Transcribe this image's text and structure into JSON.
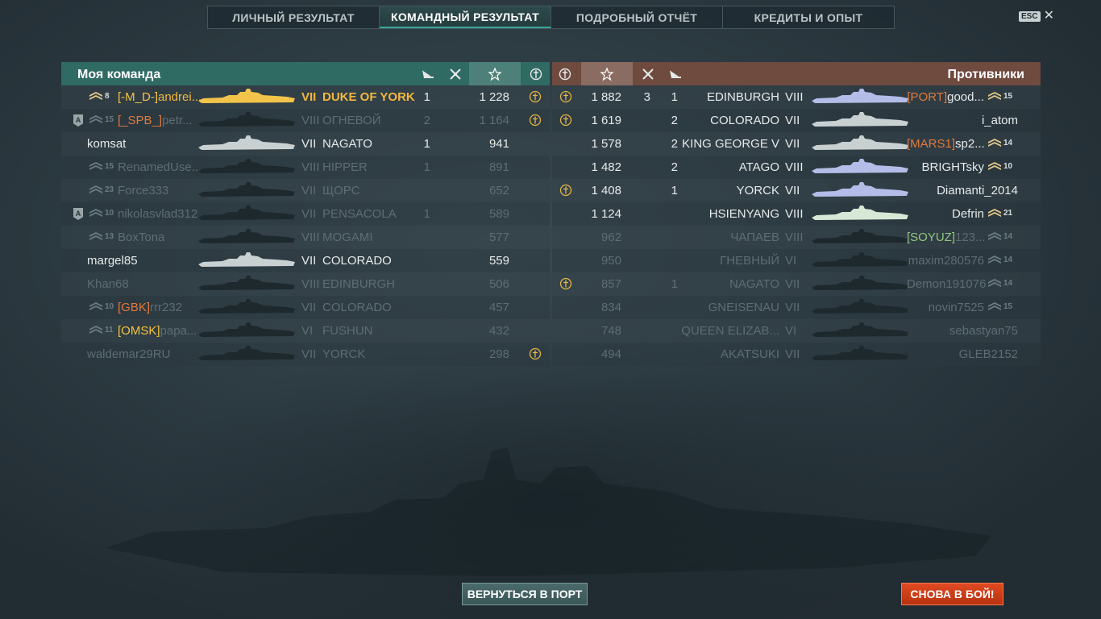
{
  "tabs": [
    {
      "label": "ЛИЧНЫЙ РЕЗУЛЬТАТ",
      "active": false
    },
    {
      "label": "КОМАНДНЫЙ РЕЗУЛЬТАТ",
      "active": true
    },
    {
      "label": "ПОДРОБНЫЙ ОТЧЁТ",
      "active": false
    },
    {
      "label": "КРЕДИТЫ И ОПЫТ",
      "active": false
    }
  ],
  "esc": {
    "key": "ESC",
    "icon": "close-icon"
  },
  "my_team": {
    "title": "Моя команда",
    "header_icons": [
      "ships-destroyed-icon",
      "planes-destroyed-icon",
      "experience-star-icon",
      "achievement-icon"
    ],
    "players": [
      {
        "rank_count": "8",
        "clan": "[-M_D-]",
        "name": "andrei...",
        "tier": "VII",
        "ship": "DUKE OF YORK",
        "kills": "1",
        "planes": "",
        "xp": "1 228",
        "badge": true,
        "alive": true,
        "self": true,
        "clan_color": "yellow"
      },
      {
        "rank_count": "15",
        "clan": "[_SPB_]",
        "name": "petr...",
        "tier": "VIII",
        "ship": "ОГНЕВОЙ",
        "kills": "2",
        "planes": "",
        "xp": "1 164",
        "badge": true,
        "alive": false,
        "abadge": "A",
        "clan_color": "orange"
      },
      {
        "rank_count": "",
        "clan": "",
        "name": "komsat",
        "tier": "VII",
        "ship": "NAGATO",
        "kills": "1",
        "planes": "",
        "xp": "941",
        "badge": false,
        "alive": true
      },
      {
        "rank_count": "15",
        "clan": "",
        "name": "RenamedUse...",
        "tier": "VIII",
        "ship": "HIPPER",
        "kills": "1",
        "planes": "",
        "xp": "891",
        "badge": false,
        "alive": false
      },
      {
        "rank_count": "23",
        "clan": "",
        "name": "Force333",
        "tier": "VII",
        "ship": "ЩОРС",
        "kills": "",
        "planes": "",
        "xp": "652",
        "badge": false,
        "alive": false
      },
      {
        "rank_count": "10",
        "clan": "",
        "name": "nikolasvlad312",
        "tier": "VII",
        "ship": "PENSACOLA",
        "kills": "1",
        "planes": "",
        "xp": "589",
        "badge": false,
        "alive": false,
        "abadge": "A"
      },
      {
        "rank_count": "13",
        "clan": "",
        "name": "BoxTona",
        "tier": "VIII",
        "ship": "MOGAMI",
        "kills": "",
        "planes": "",
        "xp": "577",
        "badge": false,
        "alive": false
      },
      {
        "rank_count": "",
        "clan": "",
        "name": "margel85",
        "tier": "VII",
        "ship": "COLORADO",
        "kills": "",
        "planes": "",
        "xp": "559",
        "badge": false,
        "alive": true
      },
      {
        "rank_count": "",
        "clan": "",
        "name": "Khan68",
        "tier": "VIII",
        "ship": "EDINBURGH",
        "kills": "",
        "planes": "",
        "xp": "506",
        "badge": false,
        "alive": false
      },
      {
        "rank_count": "10",
        "clan": "[GBK]",
        "name": "rrr232",
        "tier": "VII",
        "ship": "COLORADO",
        "kills": "",
        "planes": "",
        "xp": "457",
        "badge": false,
        "alive": false,
        "clan_color": "orange"
      },
      {
        "rank_count": "11",
        "clan": "[OMSK]",
        "name": "papa...",
        "tier": "VI",
        "ship": "FUSHUN",
        "kills": "",
        "planes": "",
        "xp": "432",
        "badge": false,
        "alive": false,
        "clan_color": "yellow"
      },
      {
        "rank_count": "",
        "clan": "",
        "name": "waldemar29RU",
        "tier": "VII",
        "ship": "YORCK",
        "kills": "",
        "planes": "",
        "xp": "298",
        "badge": true,
        "alive": false
      }
    ]
  },
  "enemy_team": {
    "title": "Противники",
    "header_icons": [
      "achievement-icon",
      "experience-star-icon",
      "planes-destroyed-icon",
      "ships-destroyed-icon"
    ],
    "players": [
      {
        "badge": true,
        "xp": "1 882",
        "planes": "3",
        "kills": "1",
        "ship": "EDINBURGH",
        "tier": "VIII",
        "clan": "[PORT]",
        "name": "good...",
        "rank_count": "15",
        "alive": true,
        "clan_color": "orange"
      },
      {
        "badge": true,
        "xp": "1 619",
        "planes": "",
        "kills": "2",
        "ship": "COLORADO",
        "tier": "VII",
        "clan": "",
        "name": "i_atom",
        "rank_count": "",
        "alive": true
      },
      {
        "badge": false,
        "xp": "1 578",
        "planes": "",
        "kills": "2",
        "ship": "KING GEORGE V",
        "tier": "VII",
        "clan": "[MARS1]",
        "name": "sp2...",
        "rank_count": "14",
        "alive": true,
        "clan_color": "orange"
      },
      {
        "badge": false,
        "xp": "1 482",
        "planes": "",
        "kills": "2",
        "ship": "ATAGO",
        "tier": "VIII",
        "clan": "",
        "name": "BRIGHTsky",
        "rank_count": "10",
        "alive": true
      },
      {
        "badge": true,
        "xp": "1 408",
        "planes": "",
        "kills": "1",
        "ship": "YORCK",
        "tier": "VII",
        "clan": "",
        "name": "Diamanti_2014",
        "rank_count": "",
        "alive": true
      },
      {
        "badge": false,
        "xp": "1 124",
        "planes": "",
        "kills": "",
        "ship": "HSIENYANG",
        "tier": "VIII",
        "clan": "",
        "name": "Defrin",
        "rank_count": "21",
        "alive": true
      },
      {
        "badge": false,
        "xp": "962",
        "planes": "",
        "kills": "",
        "ship": "ЧАПАЕВ",
        "tier": "VIII",
        "clan": "[SOYUZ]",
        "name": "123...",
        "rank_count": "14",
        "alive": false,
        "clan_color": "green"
      },
      {
        "badge": false,
        "xp": "950",
        "planes": "",
        "kills": "",
        "ship": "ГНЕВНЫЙ",
        "tier": "VI",
        "clan": "",
        "name": "maxim280576",
        "rank_count": "14",
        "alive": false
      },
      {
        "badge": true,
        "xp": "857",
        "planes": "",
        "kills": "1",
        "ship": "NAGATO",
        "tier": "VII",
        "clan": "",
        "name": "Demon191076",
        "rank_count": "14",
        "alive": false
      },
      {
        "badge": false,
        "xp": "834",
        "planes": "",
        "kills": "",
        "ship": "GNEISENAU",
        "tier": "VII",
        "clan": "",
        "name": "novin7525",
        "rank_count": "15",
        "alive": false
      },
      {
        "badge": false,
        "xp": "748",
        "planes": "",
        "kills": "",
        "ship": "QUEEN ELIZAB...",
        "tier": "VI",
        "clan": "",
        "name": "sebastyan75",
        "rank_count": "",
        "alive": false
      },
      {
        "badge": false,
        "xp": "494",
        "planes": "",
        "kills": "",
        "ship": "AKATSUKI",
        "tier": "VII",
        "clan": "",
        "name": "GLEB2152",
        "rank_count": "",
        "alive": false
      }
    ]
  },
  "buttons": {
    "port": "ВЕРНУТЬСЯ В ПОРТ",
    "battle": "СНОВА В БОЙ!"
  },
  "colors": {
    "accent": "#f3b73f",
    "ally_header": "#2f6a63",
    "enemy_header": "#6e4a3f",
    "battle_button": "#d63d18"
  }
}
